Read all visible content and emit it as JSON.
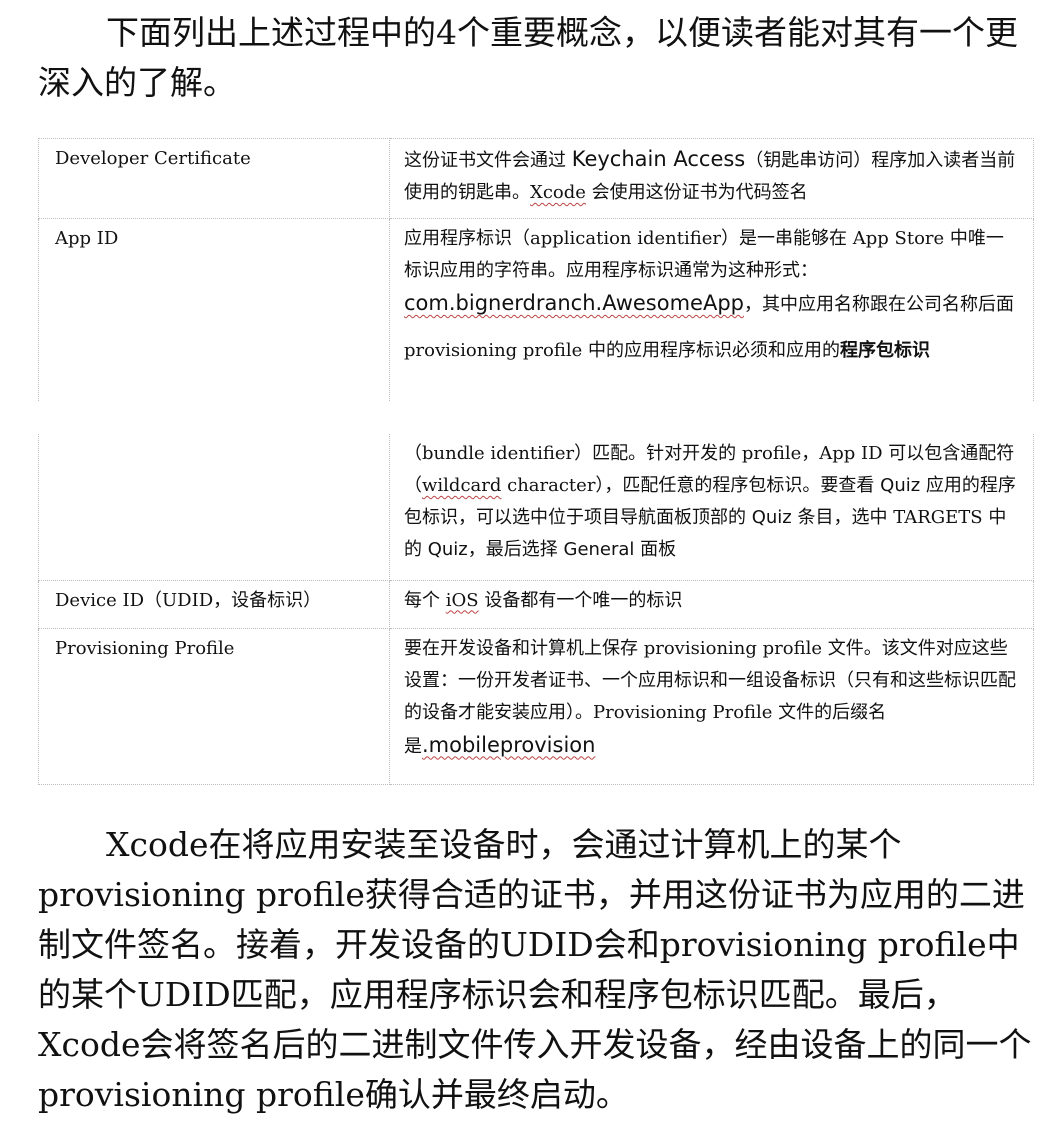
{
  "intro": "下面列出上述过程中的4个重要概念，以便读者能对其有一个更深入的了解。",
  "rows": {
    "dev_cert": {
      "term": "Developer Certificate",
      "d1": "这份证书文件会通过 ",
      "d2": "Keychain Access",
      "d3": "（钥匙串访问）程序加入读者当前使用的钥匙串。",
      "d4": "Xcode",
      "d5": " 会使用这份证书为代码签名"
    },
    "app_id": {
      "term": "App ID",
      "d1": "应用程序标识（application identifier）是一串能够在 App Store 中唯一标识应用的字符串。应用程序标识通常为这种形式：",
      "d2": "com.bignerdranch.AwesomeApp",
      "d3": "，其中应用名称跟在公司名称后面",
      "p2a": "provisioning profile 中的应用程序标识必须和应用的",
      "p2b": "程序包标识",
      "c1": "（bundle identifier）匹配。针对开发的 profile，App ID 可以包含通配符（",
      "c2": "wildcard",
      "c3": " character），匹配任意的程序包标识。要查看 ",
      "c4": "Quiz",
      "c5": " 应用的程序包标识，可以选中位于项目导航面板顶部的 ",
      "c6": "Quiz",
      "c7": " 条目，选中 TARGETS 中的 ",
      "c8": "Quiz",
      "c9": "，最后选择 ",
      "c10": "General",
      "c11": " 面板"
    },
    "device_id": {
      "term": "Device ID（UDID，设备标识）",
      "d1": "每个 ",
      "d2": "iOS",
      "d3": " 设备都有一个唯一的标识"
    },
    "prov_profile": {
      "term": "Provisioning Profile",
      "d1": "要在开发设备和计算机上保存 provisioning profile 文件。该文件对应这些设置：一份开发者证书、一个应用标识和一组设备标识（只有和这些标识匹配的设备才能安装应用）。Provisioning Profile 文件的后缀名是",
      "d2": ".mobileprovision"
    }
  },
  "outro": "Xcode在将应用安装至设备时，会通过计算机上的某个provisioning profile获得合适的证书，并用这份证书为应用的二进制文件签名。接着，开发设备的UDID会和provisioning profile中的某个UDID匹配，应用程序标识会和程序包标识匹配。最后，Xcode会将签名后的二进制文件传入开发设备，经由设备上的同一个provisioning profile确认并最终启动。"
}
